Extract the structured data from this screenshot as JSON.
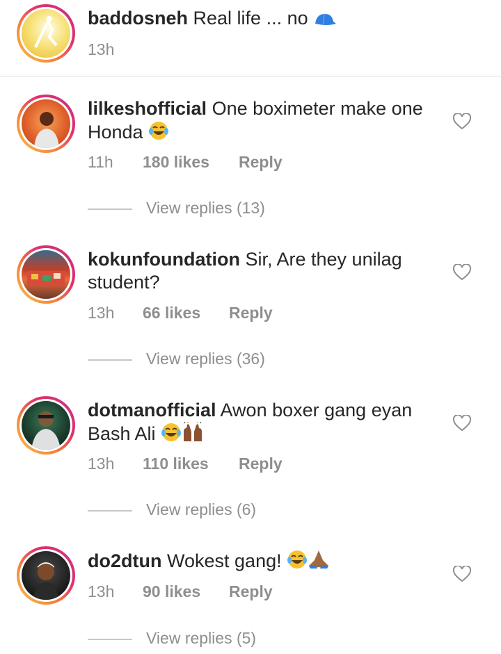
{
  "colors": {
    "username": "#262626",
    "meta": "#8e8e8e",
    "divider": "#dbdbdb",
    "ring_start": "#f9c44a",
    "ring_end": "#c13584"
  },
  "comments": [
    {
      "username": "baddosneh",
      "text": "Real life ... no",
      "text_suffix_icon": "blue-cap-emoji",
      "time": "13h"
    },
    {
      "username": "lilkeshofficial",
      "text": "One boximeter make one Honda",
      "text_suffix_icon": "tears-of-joy-emoji",
      "time": "11h",
      "likes": "180 likes",
      "reply": "Reply",
      "view_replies": "View replies (13)"
    },
    {
      "username": "kokunfoundation",
      "text": "Sir,  Are they unilag student?",
      "time": "13h",
      "likes": "66 likes",
      "reply": "Reply",
      "view_replies": "View replies (36)"
    },
    {
      "username": "dotmanofficial",
      "text": "Awon boxer gang eyan Bash Ali",
      "text_suffix_icon": "tears-of-joy-and-raised-hands-emoji",
      "time": "13h",
      "likes": "110 likes",
      "reply": "Reply",
      "view_replies": "View replies (6)"
    },
    {
      "username": "do2dtun",
      "text": "Wokest gang!",
      "text_suffix_icon": "tears-of-joy-and-folded-hands-emoji",
      "time": "13h",
      "likes": "90 likes",
      "reply": "Reply",
      "view_replies": "View replies (5)"
    }
  ]
}
